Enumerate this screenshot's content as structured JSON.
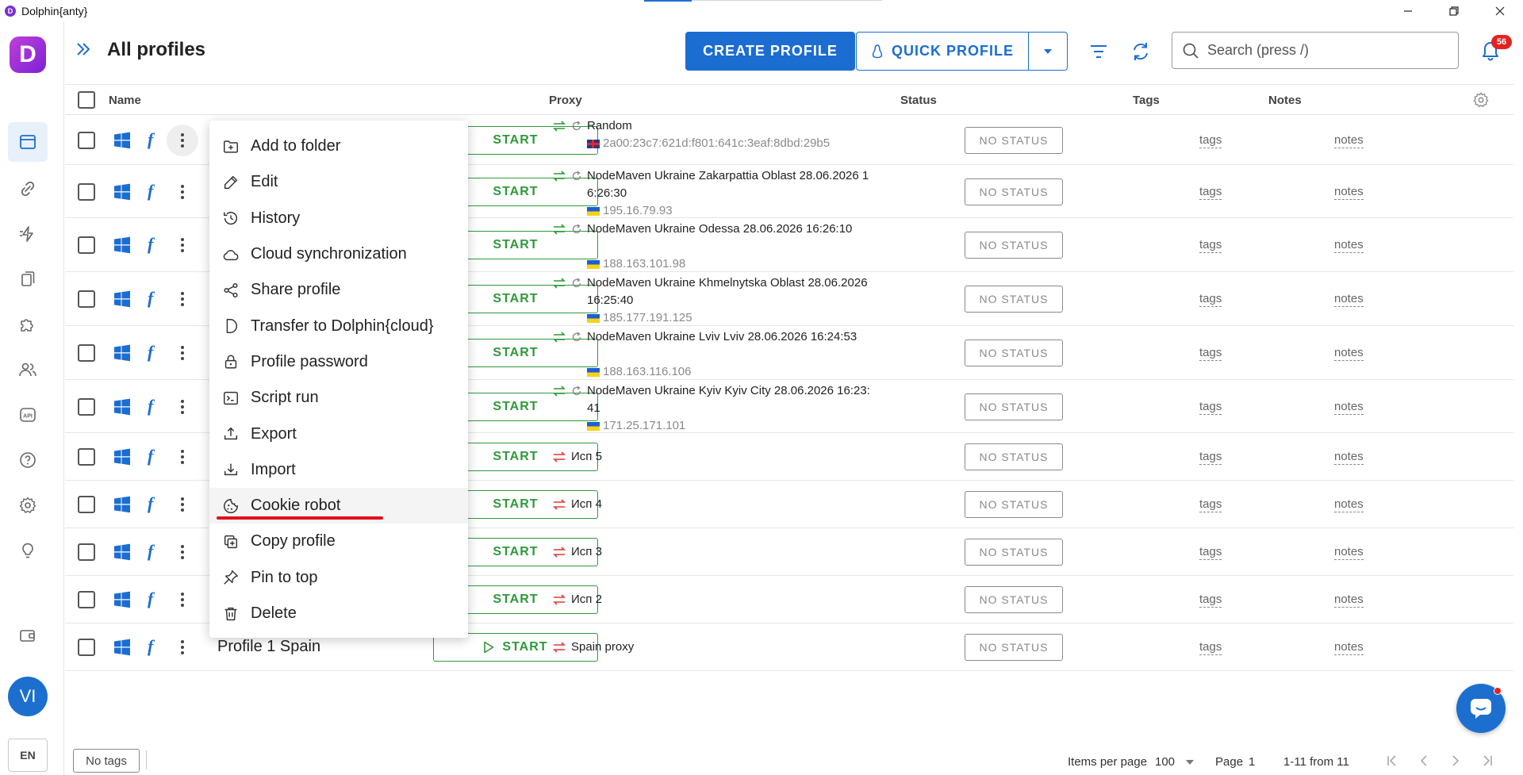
{
  "window": {
    "title": "Dolphin{anty}"
  },
  "sidebar": {
    "logo_letter": "D",
    "avatar": "VI",
    "language": "EN"
  },
  "header": {
    "title": "All profiles",
    "create_label": "CREATE PROFILE",
    "quick_label": "QUICK PROFILE",
    "search_placeholder": "Search (press /)",
    "notifications": "56"
  },
  "table": {
    "columns": {
      "name": "Name",
      "proxy": "Proxy",
      "status": "Status",
      "tags": "Tags",
      "notes": "Notes"
    },
    "start_label": "START",
    "status_label": "NO STATUS",
    "tags_label": "tags",
    "notes_label": "notes",
    "last_row_name": "Profile 1 Spain",
    "proxies": [
      {
        "line1": "Random",
        "line2": "",
        "ip": "2a00:23c7:621d:f801:641c:3eaf:8dbd:29b5",
        "flag": "uk"
      },
      {
        "line1": "NodeMaven Ukraine Zakarpattia Oblast 28.06.2026 1",
        "line2": "6:26:30",
        "ip": "195.16.79.93",
        "flag": "ua"
      },
      {
        "line1": "NodeMaven Ukraine Odessa 28.06.2026 16:26:10",
        "line2": "",
        "ip": "188.163.101.98",
        "flag": "ua"
      },
      {
        "line1": "NodeMaven Ukraine Khmelnytska Oblast 28.06.2026",
        "line2": "16:25:40",
        "ip": "185.177.191.125",
        "flag": "ua"
      },
      {
        "line1": "NodeMaven Ukraine Lviv Lviv 28.06.2026 16:24:53",
        "line2": "",
        "ip": "188.163.116.106",
        "flag": "ua"
      },
      {
        "line1": "NodeMaven Ukraine Kyiv Kyiv City 28.06.2026 16:23:",
        "line2": "41",
        "ip": "171.25.171.101",
        "flag": "ua"
      },
      {
        "line1": "Исп 5"
      },
      {
        "line1": "Исп 4"
      },
      {
        "line1": "Исп 3"
      },
      {
        "line1": "Исп 2"
      },
      {
        "line1": "Spain proxy"
      }
    ]
  },
  "context_menu": {
    "items": [
      "Add to folder",
      "Edit",
      "History",
      "Cloud synchronization",
      "Share profile",
      "Transfer to Dolphin{cloud}",
      "Profile password",
      "Script run",
      "Export",
      "Import",
      "Cookie robot",
      "Copy profile",
      "Pin to top",
      "Delete"
    ],
    "highlighted_index": 10
  },
  "footer": {
    "no_tags_label": "No tags",
    "items_per_page_label": "Items per page",
    "items_per_page_value": "100",
    "page_label": "Page",
    "page_value": "1",
    "range_label": "1-11 from 11"
  },
  "colors": {
    "primary": "#1b6dd2",
    "start_green": "#2e9a3a",
    "highlight_red": "#e2101a"
  }
}
